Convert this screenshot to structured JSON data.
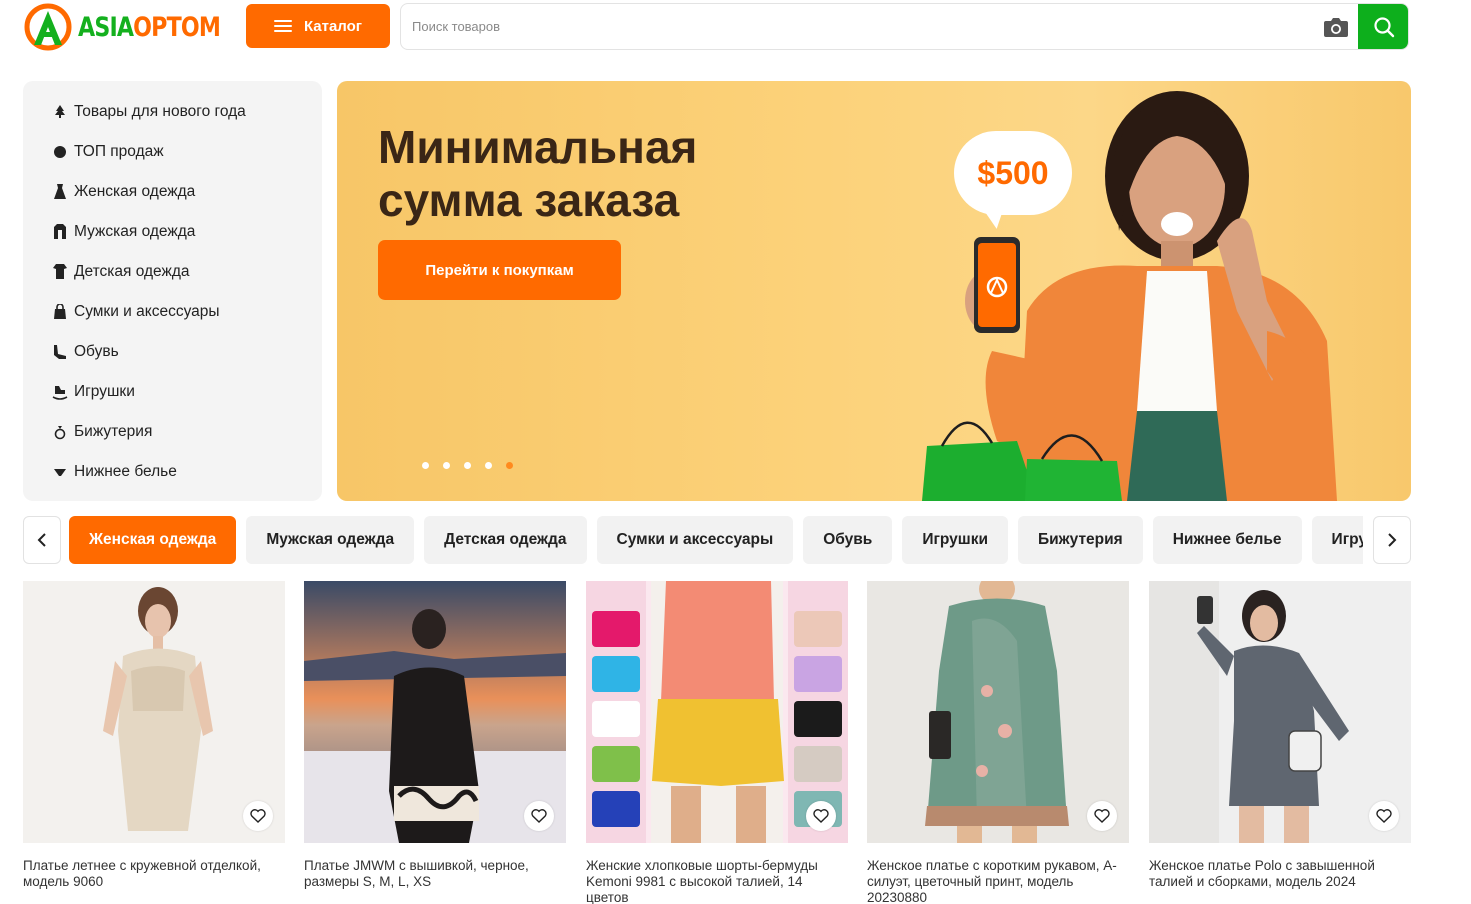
{
  "brand": {
    "asia": "ASIA",
    "optom": "OPTOM",
    "logo_icon": "asiaoptom-logo",
    "colors": {
      "green": "#14b01e",
      "orange": "#ff6a00"
    }
  },
  "header": {
    "catalog_label": "Каталог",
    "catalog_icon": "menu-icon",
    "search_placeholder": "Поиск товаров",
    "search_value": "",
    "camera_icon": "camera-icon",
    "search_icon": "search-icon"
  },
  "sidebar": {
    "items": [
      {
        "label": "Товары для нового года",
        "icon": "tree-icon"
      },
      {
        "label": "ТОП продаж",
        "icon": "badge-icon"
      },
      {
        "label": "Женская одежда",
        "icon": "dress-icon"
      },
      {
        "label": "Мужская одежда",
        "icon": "coat-icon"
      },
      {
        "label": "Детская одежда",
        "icon": "kids-clothes-icon"
      },
      {
        "label": "Сумки и аксессуары",
        "icon": "bag-icon"
      },
      {
        "label": "Обувь",
        "icon": "shoe-icon"
      },
      {
        "label": "Игрушки",
        "icon": "rocking-horse-icon"
      },
      {
        "label": "Бижутерия",
        "icon": "ring-icon"
      },
      {
        "label": "Нижнее белье",
        "icon": "underwear-icon"
      }
    ]
  },
  "banner": {
    "title_line1": "Минимальная",
    "title_line2": "сумма заказа",
    "price": "$500",
    "cta_label": "Перейти к покупкам",
    "slides_total": 5,
    "active_slide": 5
  },
  "tabs": {
    "items": [
      "Женская одежда",
      "Мужская одежда",
      "Детская одежда",
      "Сумки и аксессуары",
      "Обувь",
      "Игрушки",
      "Бижутерия",
      "Нижнее белье",
      "Игрушки"
    ],
    "active_index": 0,
    "prev_icon": "chevron-left-icon",
    "next_icon": "chevron-right-icon"
  },
  "products": [
    {
      "title": "Платье летнее с кружевной отделкой, модель 9060",
      "icon": "heart-icon"
    },
    {
      "title": "Платье JMWM с вышивкой, черное, размеры S, M, L, XS",
      "icon": "heart-icon"
    },
    {
      "title": "Женские хлопковые шорты-бермуды Kemoni 9981 с высокой талией, 14 цветов",
      "icon": "heart-icon"
    },
    {
      "title": "Женское платье с коротким рукавом, А-силуэт, цветочный принт, модель 20230880",
      "icon": "heart-icon"
    },
    {
      "title": "Женское платье Polo с завышенной талией и сборками, модель 2024",
      "icon": "heart-icon"
    }
  ]
}
